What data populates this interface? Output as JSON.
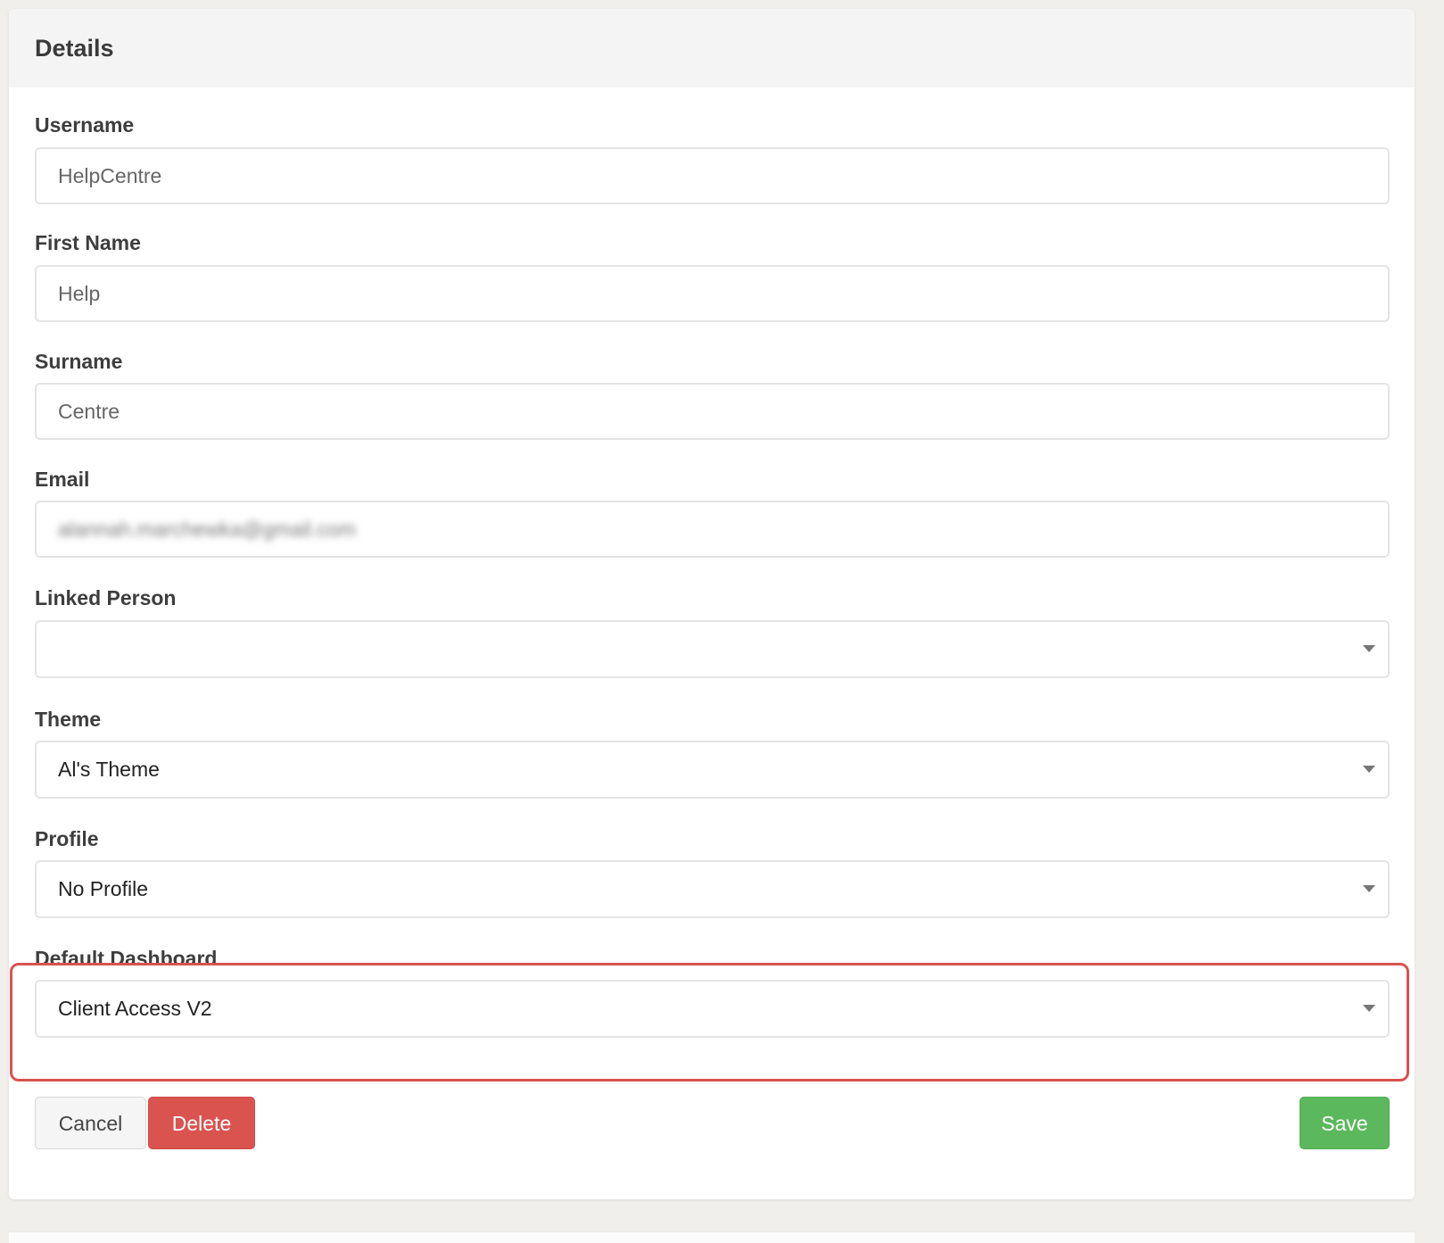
{
  "panel": {
    "title": "Details"
  },
  "fields": {
    "username": {
      "label": "Username",
      "value": "HelpCentre"
    },
    "first_name": {
      "label": "First Name",
      "value": "Help"
    },
    "surname": {
      "label": "Surname",
      "value": "Centre"
    },
    "email": {
      "label": "Email",
      "value": "alannah.marchewka@gmail.com"
    },
    "linked_person": {
      "label": "Linked Person",
      "value": ""
    },
    "theme": {
      "label": "Theme",
      "value": "Al's Theme"
    },
    "profile": {
      "label": "Profile",
      "value": "No Profile"
    },
    "default_dashboard": {
      "label": "Default Dashboard",
      "value": "Client Access V2"
    }
  },
  "buttons": {
    "cancel": "Cancel",
    "delete": "Delete",
    "save": "Save"
  },
  "colors": {
    "danger": "#d9534f",
    "success": "#5cb85c",
    "highlight": "#d9534f"
  }
}
